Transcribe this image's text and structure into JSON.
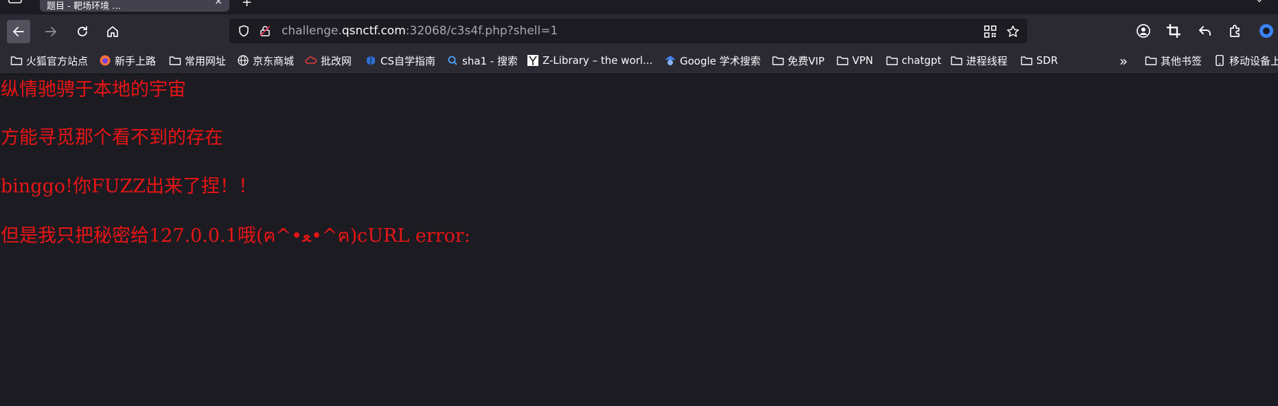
{
  "tab": {
    "title": "题目 - 靶场环境 …",
    "close": "×"
  },
  "urlbar": {
    "prefix": "challenge.",
    "host": "qsnctf.com",
    "rest": ":32068/c3s4f.php?shell=1"
  },
  "bookmarks": [
    {
      "label": "火狐官方站点",
      "icon": "folder-icon"
    },
    {
      "label": "新手上路",
      "icon": "firefox-icon"
    },
    {
      "label": "常用网址",
      "icon": "folder-icon"
    },
    {
      "label": "京东商城",
      "icon": "globe-icon"
    },
    {
      "label": "批改网",
      "icon": "cloud-icon"
    },
    {
      "label": "CS自学指南",
      "icon": "cube-icon"
    },
    {
      "label": "sha1 - 搜索",
      "icon": "search-icon"
    },
    {
      "label": "Z-Library – the worl...",
      "icon": "zlib-icon"
    },
    {
      "label": "Google 学术搜索",
      "icon": "scholar-icon"
    },
    {
      "label": "免费VIP",
      "icon": "folder-icon"
    },
    {
      "label": "VPN",
      "icon": "folder-icon"
    },
    {
      "label": "chatgpt",
      "icon": "folder-icon"
    },
    {
      "label": "进程线程",
      "icon": "folder-icon"
    },
    {
      "label": "SDR",
      "icon": "folder-icon"
    }
  ],
  "bookmarks_overflow": {
    "other_label": "其他书签",
    "mobile_label": "移动设备上"
  },
  "page": {
    "lines": [
      "纵情驰骋于本地的宇宙",
      "方能寻觅那个看不到的存在",
      "binggo!你FUZZ出来了捏！！",
      "但是我只把秘密给127.0.0.1哦(ฅ^•ﻌ•^ฅ)cURL error:"
    ]
  },
  "colors": {
    "page_bg": "#1c1b22",
    "toolbar_bg": "#2b2a33",
    "text_red": "#e81515"
  }
}
